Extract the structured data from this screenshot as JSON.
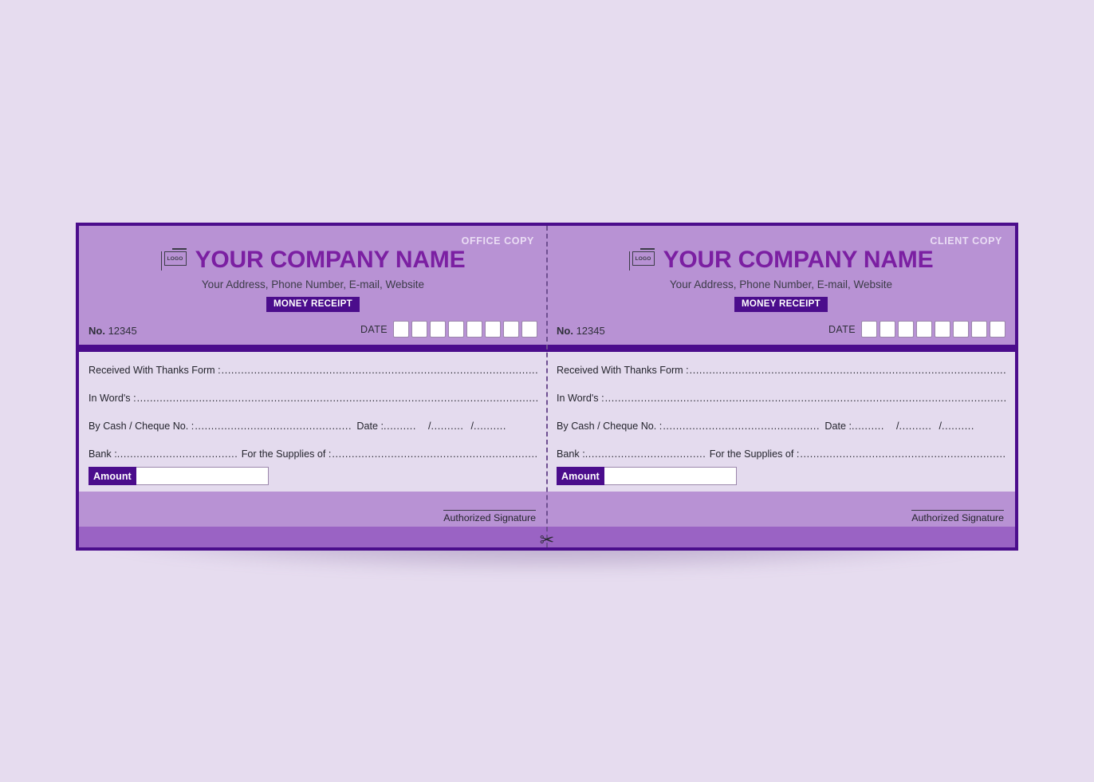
{
  "document": {
    "type": "money-receipt",
    "colors": {
      "page_background": "#e6dcef",
      "card_border": "#4b0d8c",
      "header_background": "#b892d4",
      "body_background": "#e4dbee",
      "accent_dark": "#4b0d8c",
      "company_name_color": "#7b1fa2",
      "bottom_strip": "#9a63c4"
    }
  },
  "panels": [
    {
      "copy_tag": "OFFICE COPY",
      "logo": {
        "icon": "logo-frame-icon",
        "text": "LOGO"
      },
      "company_name": "YOUR COMPANY NAME",
      "company_address": "Your Address, Phone Number, E-mail, Website",
      "badge": "MONEY RECEIPT",
      "number_label": "No.",
      "number_value": "12345",
      "date_label": "DATE",
      "date_box_count": 8,
      "fields": {
        "received_from_label": "Received With Thanks Form :",
        "in_words_label": "In Word's :",
        "cheque_label": "By Cash / Cheque  No. :",
        "cheque_date_label": "Date :",
        "bank_label": "Bank :",
        "supplies_label": "For the Supplies of :"
      },
      "amount_label": "Amount",
      "amount_value": "",
      "signature_label": "Authorized Signature"
    },
    {
      "copy_tag": "CLIENT COPY",
      "logo": {
        "icon": "logo-frame-icon",
        "text": "LOGO"
      },
      "company_name": "YOUR COMPANY NAME",
      "company_address": "Your Address, Phone Number, E-mail, Website",
      "badge": "MONEY RECEIPT",
      "number_label": "No.",
      "number_value": "12345",
      "date_label": "DATE",
      "date_box_count": 8,
      "fields": {
        "received_from_label": "Received With Thanks Form :",
        "in_words_label": "In Word's :",
        "cheque_label": "By Cash / Cheque  No. :",
        "cheque_date_label": "Date :",
        "bank_label": "Bank :",
        "supplies_label": "For the Supplies of :"
      },
      "amount_label": "Amount",
      "amount_value": "",
      "signature_label": "Authorized Signature"
    }
  ],
  "tear_line": {
    "icon": "scissors-icon",
    "glyph": "✂"
  },
  "dot_fills": {
    "long": "...........................................................................................................................................................................................................................................................",
    "bank": "....................................................",
    "date_seg": "..........",
    "date_sep": "/"
  }
}
